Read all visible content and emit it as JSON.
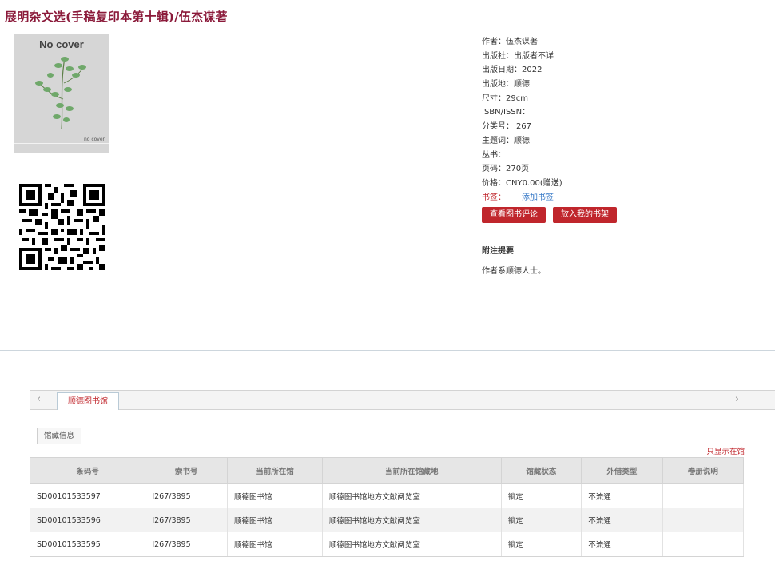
{
  "title": "展明杂文选(手稿复印本第十辑)/伍杰谋著",
  "cover": {
    "main_text": "No cover",
    "corner_text": "no cover"
  },
  "details": [
    "作者：伍杰谋著",
    "出版社：出版者不详",
    "出版日期：2022",
    "出版地：顺德",
    "尺寸：29cm",
    "ISBN/ISSN：",
    "分类号：I267",
    "主题词：顺德",
    "丛书：",
    "页码：270页",
    "价格：CNY0.00(赠送)"
  ],
  "bookmark": {
    "label": "书签：",
    "link": "添加书签"
  },
  "buttons": {
    "reviews": "查看图书评论",
    "shelf": "放入我的书架"
  },
  "note": {
    "title": "附注提要",
    "text": "作者系顺德人士。"
  },
  "tabs": {
    "library": "顺德图书馆",
    "holdings": "馆藏信息",
    "prev_arrow": "‹",
    "next_arrow": "›"
  },
  "filter_link": "只显示在馆",
  "table": {
    "headers": [
      "条码号",
      "索书号",
      "当前所在馆",
      "当前所在馆藏地",
      "馆藏状态",
      "外借类型",
      "卷册说明"
    ],
    "rows": [
      [
        "SD00101533597",
        "I267/3895",
        "顺德图书馆",
        "顺德图书馆地方文献阅览室",
        "锁定",
        "不流通",
        ""
      ],
      [
        "SD00101533596",
        "I267/3895",
        "顺德图书馆",
        "顺德图书馆地方文献阅览室",
        "锁定",
        "不流通",
        ""
      ],
      [
        "SD00101533595",
        "I267/3895",
        "顺德图书馆",
        "顺德图书馆地方文献阅览室",
        "锁定",
        "不流通",
        ""
      ]
    ]
  },
  "colors": {
    "accent": "#c0262c",
    "title": "#8b1a3a",
    "link": "#3a7bc8"
  },
  "icons": {
    "qr": "qr-code-icon",
    "cover_plant": "plant-illustration"
  }
}
